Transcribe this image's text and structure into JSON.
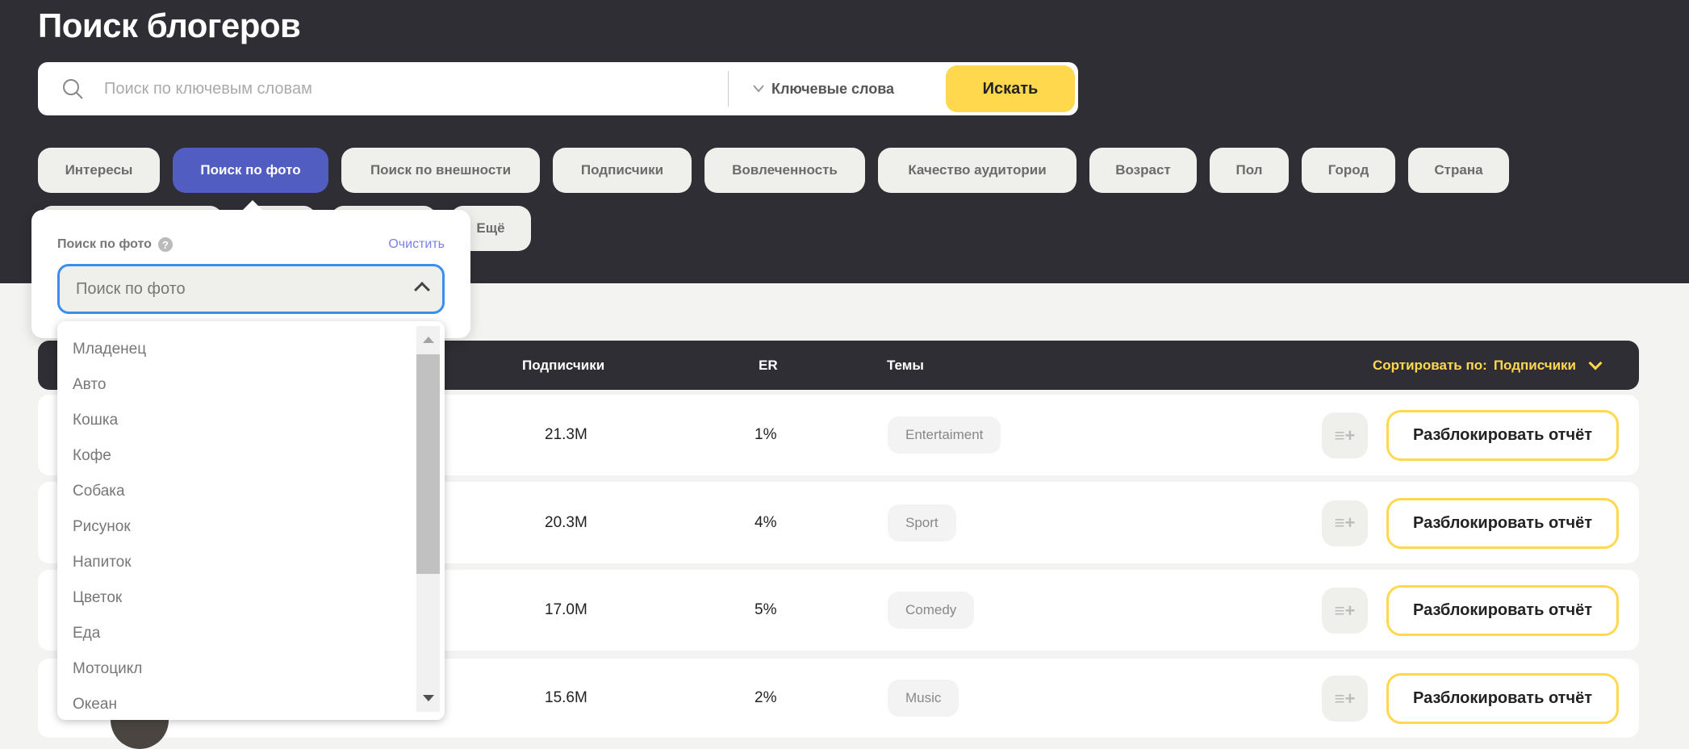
{
  "page": {
    "title": "Поиск блогеров"
  },
  "search": {
    "placeholder": "Поиск по ключевым словам",
    "value": "",
    "mode_label": "Ключевые слова",
    "submit_label": "Искать"
  },
  "filters": {
    "chips": [
      "Интересы",
      "Поиск по фото",
      "Поиск по внешности",
      "Подписчики",
      "Вовлеченность",
      "Качество аудитории",
      "Возраст",
      "Пол",
      "Город",
      "Страна"
    ],
    "active": "Поиск по фото",
    "more_label": "Ещё"
  },
  "photo_popover": {
    "label": "Поиск по фото",
    "clear_label": "Очистить",
    "select_placeholder": "Поиск по фото",
    "options": [
      "Младенец",
      "Авто",
      "Кошка",
      "Кофе",
      "Собака",
      "Рисунок",
      "Напиток",
      "Цветок",
      "Еда",
      "Мотоцикл",
      "Океан"
    ]
  },
  "table": {
    "headers": {
      "subscribers": "Подписчики",
      "er": "ER",
      "topics": "Темы"
    },
    "sort": {
      "label": "Сортировать по:",
      "value": "Подписчики"
    },
    "unlock_label": "Разблокировать отчёт",
    "rows": [
      {
        "subscribers": "21.3M",
        "er": "1%",
        "topic": "Entertaiment"
      },
      {
        "subscribers": "20.3M",
        "er": "4%",
        "topic": "Sport"
      },
      {
        "subscribers": "17.0M",
        "er": "5%",
        "topic": "Comedy"
      },
      {
        "subscribers": "15.6M",
        "er": "2%",
        "topic": "Music"
      }
    ]
  },
  "colors": {
    "header_bg": "#2f2e35",
    "accent_yellow": "#ffd84d",
    "active_chip": "#525dc1",
    "focus_blue": "#3a8ef0"
  }
}
